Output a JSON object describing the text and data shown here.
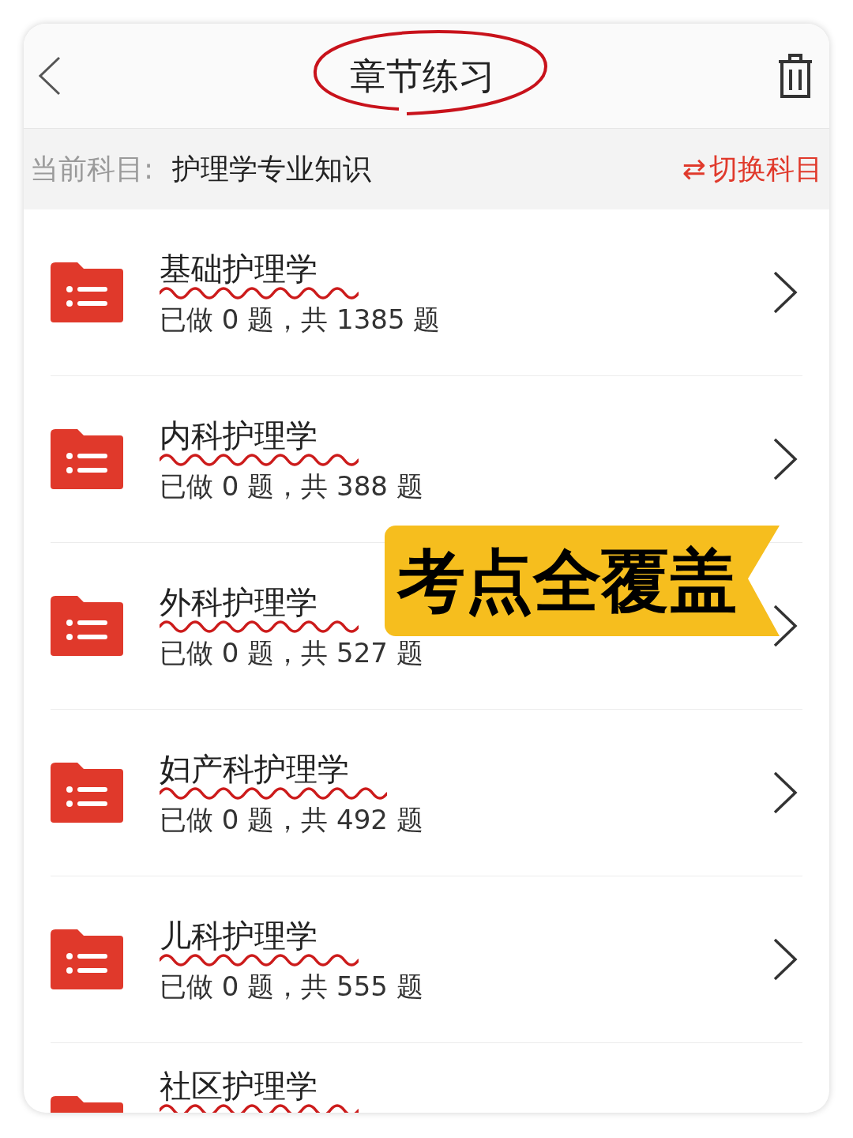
{
  "header": {
    "title": "章节练习"
  },
  "subject": {
    "label": "当前科目:",
    "value": "护理学专业知识",
    "switch_icon": "⇄",
    "switch_label": "切换科目"
  },
  "chapters": [
    {
      "title": "基础护理学",
      "progress": "已做 0 题，共 1385 题"
    },
    {
      "title": "内科护理学",
      "progress": "已做 0 题，共 388 题"
    },
    {
      "title": "外科护理学",
      "progress": "已做 0 题，共 527 题"
    },
    {
      "title": "妇产科护理学",
      "progress": "已做 0 题，共 492 题"
    },
    {
      "title": "儿科护理学",
      "progress": "已做 0 题，共 555 题"
    },
    {
      "title": "社区护理学"
    }
  ],
  "banner": {
    "text": "考点全覆盖"
  }
}
